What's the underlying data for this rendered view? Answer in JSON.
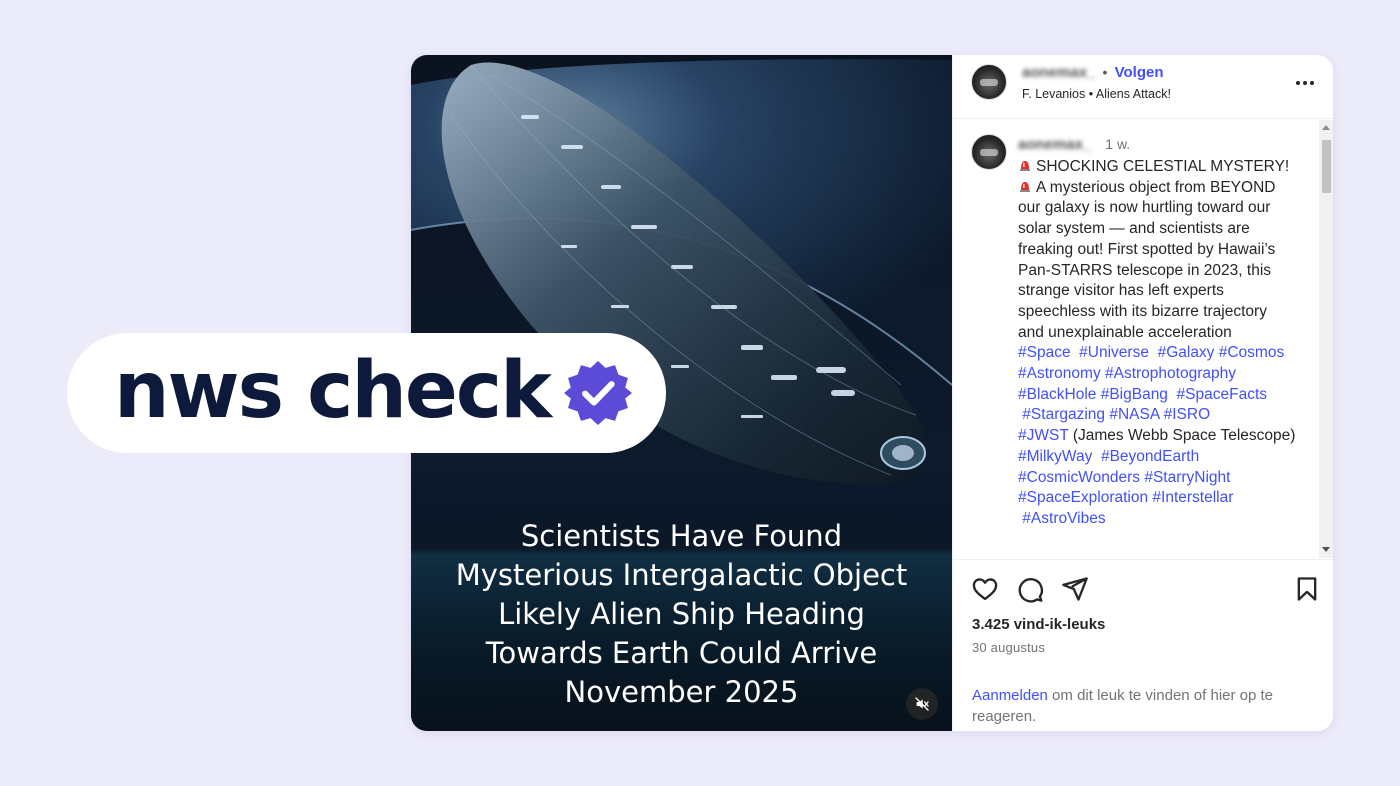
{
  "badge": {
    "label": "nws check",
    "color": "#0e1a3c",
    "check_color": "#5b4bd6",
    "check_icon": "verified-badge-icon"
  },
  "media": {
    "caption_lines": [
      "Scientists Have Found",
      "Mysterious Intergalactic Object",
      "Likely Alien Ship Heading",
      "Towards Earth Could Arrive",
      "November 2025"
    ],
    "mute_icon": "muted-speaker-icon"
  },
  "post_header": {
    "username": "aonemax_",
    "separator": "•",
    "follow_label": "Volgen",
    "audio_artist": "F. Levanios",
    "audio_sep": "•",
    "audio_title": "Aliens Attack!",
    "more_icon": "more-options-icon"
  },
  "comment": {
    "username": "aonemax_",
    "time": "1 w.",
    "lines": [
      "SHOCKING CELESTIAL MYSTERY!",
      "A mysterious object from BEYOND",
      "our galaxy is now hurtling toward our",
      "solar system — and scientists are",
      "freaking out!  First spotted by Hawaii’s",
      "Pan-STARRS telescope in 2023, this",
      "strange visitor has left experts",
      "speechless with its bizarre trajectory",
      "and unexplainable acceleration"
    ],
    "hashtag_lines": [
      "#Space  #Universe  #Galaxy #Cosmos",
      "#Astronomy #Astrophotography",
      "#BlackHole #BigBang  #SpaceFacts",
      " #Stargazing #NASA #ISRO"
    ],
    "jwst_tag": "#JWST",
    "jwst_text": " (James Webb Space Telescope)",
    "hashtag_lines_2": [
      "#MilkyWay  #BeyondEarth",
      "#CosmicWonders #StarryNight",
      "#SpaceExploration #Interstellar",
      " #AstroVibes"
    ]
  },
  "actions": {
    "like_icon": "heart-icon",
    "comment_icon": "comment-bubble-icon",
    "share_icon": "share-plane-icon",
    "save_icon": "bookmark-icon",
    "likes": "3.425 vind-ik-leuks",
    "date": "30 augustus",
    "login_link": "Aanmelden",
    "login_text": " om dit leuk te vinden of hier op te reageren."
  },
  "colors": {
    "background": "#ecebfa",
    "link": "#4150f7",
    "text": "#262626",
    "muted": "#737373"
  }
}
